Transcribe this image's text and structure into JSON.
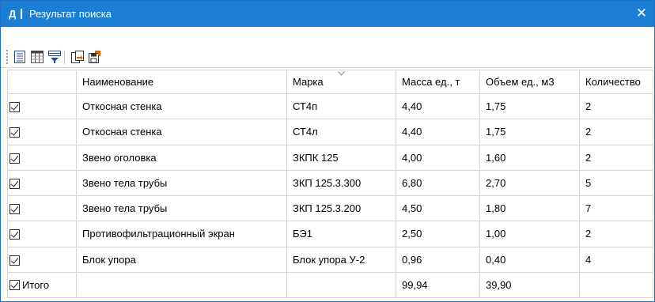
{
  "window": {
    "icon_letter": "Д",
    "title": "Результат поиска",
    "close_symbol": "✕"
  },
  "toolbar": {
    "buttons": [
      "list-view-icon",
      "columns-setup-icon",
      "filter-sort-icon",
      "export-icon",
      "save-export-icon"
    ]
  },
  "columns": [
    "Наименование",
    "Марка",
    "Масса ед., т",
    "Объем ед., м3",
    "Количество"
  ],
  "rows": [
    {
      "checked": true,
      "name": "Откосная стенка",
      "mark": "СТ4п",
      "mass": "4,40",
      "volume": "1,75",
      "qty": "2"
    },
    {
      "checked": true,
      "name": "Откосная стенка",
      "mark": "СТ4л",
      "mass": "4,40",
      "volume": "1,75",
      "qty": "2"
    },
    {
      "checked": true,
      "name": "Звено оголовка",
      "mark": "ЗКПК 125",
      "mass": "4,00",
      "volume": "1,60",
      "qty": "2"
    },
    {
      "checked": true,
      "name": "Звено тела трубы",
      "mark": "ЗКП 125.3.300",
      "mass": "6,80",
      "volume": "2,70",
      "qty": "5"
    },
    {
      "checked": true,
      "name": "Звено тела трубы",
      "mark": "ЗКП 125.3.200",
      "mass": "4,50",
      "volume": "1,80",
      "qty": "7"
    },
    {
      "checked": true,
      "name": "Противофильтрационный экран",
      "mark": "БЭ1",
      "mass": "2,50",
      "volume": "1,00",
      "qty": "2"
    },
    {
      "checked": true,
      "name": "Блок упора",
      "mark": "Блок упора У-2",
      "mass": "0,96",
      "volume": "0,40",
      "qty": "4"
    }
  ],
  "total": {
    "label": "Итого",
    "mass": "99,94",
    "volume": "39,90"
  },
  "colors": {
    "titlebar": "#1a7fd4",
    "border": "#1a73c8",
    "grid_line": "#d4d4d4"
  }
}
